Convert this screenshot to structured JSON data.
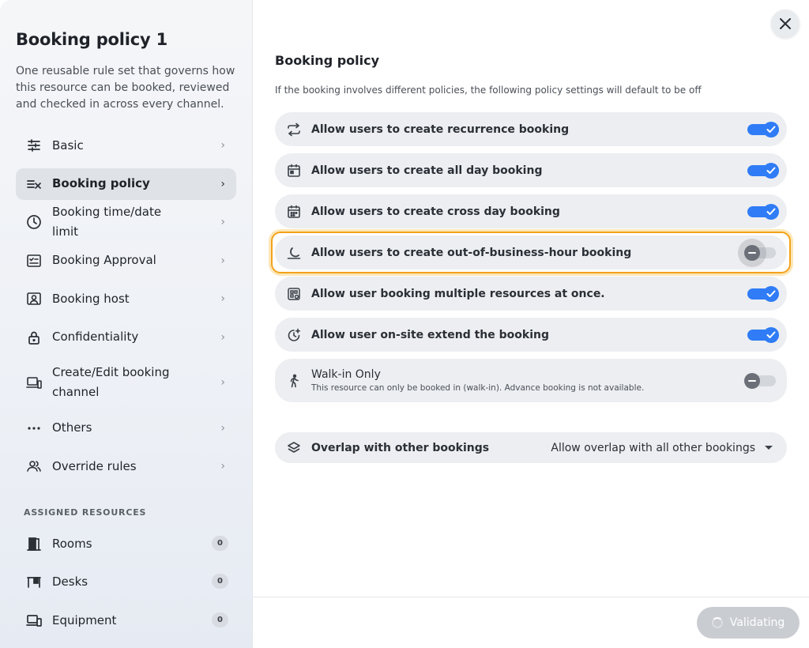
{
  "sidebar": {
    "title": "Booking policy 1",
    "description": "One reusable rule set that governs how this resource can be booked, reviewed and checked in across every channel.",
    "items": [
      {
        "label": "Basic",
        "icon": "sliders-icon"
      },
      {
        "label": "Booking policy",
        "icon": "policy-list-check-icon",
        "active": true
      },
      {
        "label": "Booking time/date limit",
        "icon": "clock-icon"
      },
      {
        "label": "Booking Approval",
        "icon": "approval-checklist-icon"
      },
      {
        "label": "Booking host",
        "icon": "host-badge-icon"
      },
      {
        "label": "Confidentiality",
        "icon": "lock-icon"
      },
      {
        "label": "Create/Edit booking channel",
        "icon": "devices-icon"
      },
      {
        "label": "Others",
        "icon": "more-dots-icon"
      },
      {
        "label": "Override rules",
        "icon": "users-icon"
      }
    ],
    "assigned_label": "ASSIGNED RESOURCES",
    "resources": [
      {
        "label": "Rooms",
        "count": "0",
        "icon": "door-icon"
      },
      {
        "label": "Desks",
        "count": "0",
        "icon": "desk-icon"
      },
      {
        "label": "Equipment",
        "count": "0",
        "icon": "equipment-devices-icon"
      }
    ]
  },
  "main": {
    "title": "Booking policy",
    "subtitle": "If the booking involves different policies, the following policy settings will default to be off",
    "policies": [
      {
        "label": "Allow users to create recurrence booking",
        "icon": "repeat-icon",
        "enabled": true
      },
      {
        "label": "Allow users to create all day booking",
        "icon": "calendar-day-icon",
        "enabled": true
      },
      {
        "label": "Allow users to create cross day booking",
        "icon": "calendar-icon",
        "enabled": true
      },
      {
        "label": "Allow users to create out-of-business-hour booking",
        "icon": "moon-icon",
        "enabled": false
      },
      {
        "label": "Allow user booking multiple resources at once.",
        "icon": "multi-resource-icon",
        "enabled": true
      },
      {
        "label": "Allow user on-site extend the booking",
        "icon": "clock-extend-icon",
        "enabled": true
      }
    ],
    "walkin": {
      "label": "Walk-in Only",
      "description": "This resource can only be booked in (walk-in). Advance booking is not available.",
      "icon": "walking-person-icon",
      "enabled": false
    },
    "overlap": {
      "label": "Overlap with other bookings",
      "value": "Allow overlap with all other bookings",
      "icon": "layers-icon"
    }
  },
  "footer": {
    "validate_label": "Validating"
  },
  "colors": {
    "accent": "#2f7cf6",
    "focus": "#f3a21a",
    "disabled_button": "#c9ccd1"
  }
}
